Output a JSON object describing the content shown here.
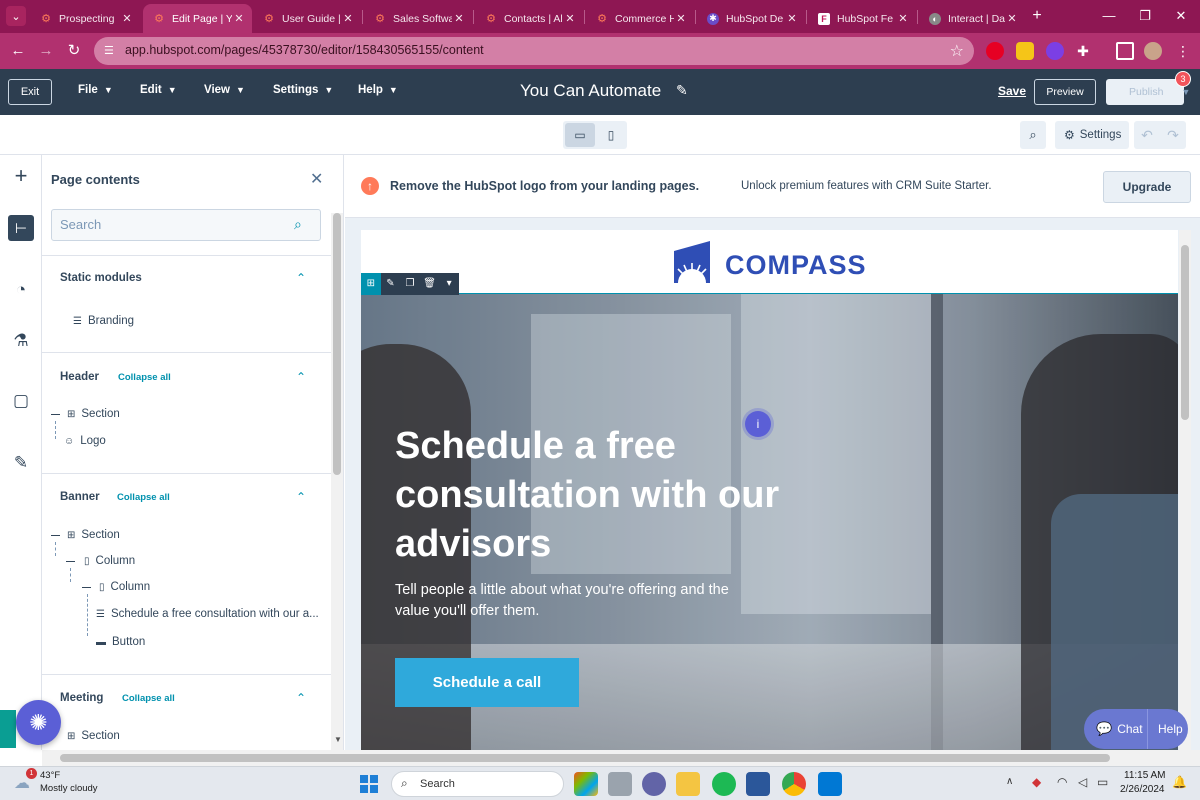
{
  "browser": {
    "tabs": [
      {
        "title": "Prospecting",
        "active": false,
        "icon": "hubspot-sprocket-icon"
      },
      {
        "title": "Edit Page | Yo",
        "active": true,
        "icon": "hubspot-sprocket-icon"
      },
      {
        "title": "User Guide |",
        "active": false,
        "icon": "hubspot-sprocket-icon"
      },
      {
        "title": "Sales Softwa",
        "active": false,
        "icon": "hubspot-sprocket-icon"
      },
      {
        "title": "Contacts | Al",
        "active": false,
        "icon": "hubspot-sprocket-icon"
      },
      {
        "title": "Commerce H",
        "active": false,
        "icon": "hubspot-sprocket-icon"
      },
      {
        "title": "HubSpot De",
        "active": false,
        "icon": "gear-purple-icon"
      },
      {
        "title": "HubSpot Fe",
        "active": false,
        "icon": "feature-board-icon"
      },
      {
        "title": "Interact | Da",
        "active": false,
        "icon": "globe-icon"
      }
    ],
    "url": "app.hubspot.com/pages/45378730/editor/158430565155/content"
  },
  "hs_nav": {
    "exit_label": "Exit",
    "menus": [
      "File",
      "View",
      "Settings",
      "Help"
    ],
    "edit_menu": "Edit",
    "page_title": "You Can Automate",
    "save_label": "Save",
    "preview_label": "Preview",
    "publish_label": "Publish",
    "notification_count": "3"
  },
  "toolbar": {
    "settings_label": "Settings"
  },
  "panel": {
    "title": "Page contents",
    "search_placeholder": "Search",
    "sections": {
      "static_modules": {
        "title": "Static modules",
        "items": [
          "Branding"
        ]
      },
      "header": {
        "title": "Header",
        "collapse_label": "Collapse all",
        "items": [
          "Section",
          "Logo"
        ]
      },
      "banner": {
        "title": "Banner",
        "collapse_label": "Collapse all",
        "items": [
          "Section",
          "Column",
          "Column",
          "Schedule a free consultation with our a...",
          "Button"
        ]
      },
      "meeting": {
        "title": "Meeting",
        "collapse_label": "Collapse all",
        "items": [
          "Section"
        ]
      }
    }
  },
  "upsell": {
    "title": "Remove the HubSpot logo from your landing pages.",
    "text": "Unlock premium features with CRM Suite Starter.",
    "button_label": "Upgrade"
  },
  "landing_page": {
    "logo_text": "COMPASS",
    "hero": {
      "heading": "Schedule a free consultation with our advisors",
      "subtext": "Tell people a little about what you're offering and the value you'll offer them.",
      "cta_label": "Schedule a call"
    },
    "info_marker": "i"
  },
  "chat_widget": {
    "chat_label": "Chat",
    "help_label": "Help"
  },
  "taskbar": {
    "weather_temp": "43°F",
    "weather_desc": "Mostly cloudy",
    "weather_badge": "1",
    "search_label": "Search",
    "time": "11:15 AM",
    "date": "2/26/2024"
  },
  "colors": {
    "browser_chrome": "#8e1753",
    "hubspot_nav": "#2d3e50",
    "accent_teal": "#0091ae",
    "cta_blue": "#2fa9db",
    "compass_blue": "#2f4eb5",
    "chat_purple": "#6a78d1",
    "upsell_orange": "#ff7a59"
  }
}
